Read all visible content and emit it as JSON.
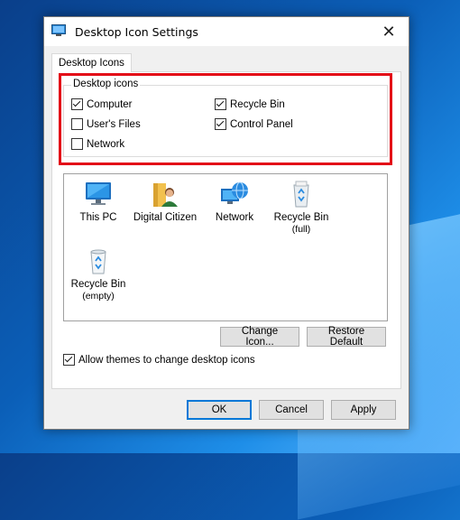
{
  "window": {
    "title": "Desktop Icon Settings",
    "close_glyph": "✕"
  },
  "tabs": [
    {
      "label": "Desktop Icons",
      "selected": true
    }
  ],
  "desktop_icons_group": {
    "legend": "Desktop icons",
    "checkboxes": [
      {
        "label": "Computer",
        "checked": true
      },
      {
        "label": "Recycle Bin",
        "checked": true
      },
      {
        "label": "User's Files",
        "checked": false
      },
      {
        "label": "Control Panel",
        "checked": true
      },
      {
        "label": "Network",
        "checked": false
      }
    ]
  },
  "icon_list": [
    {
      "label": "This PC",
      "sub": "",
      "icon": "monitor-icon"
    },
    {
      "label": "Digital Citizen",
      "sub": "",
      "icon": "user-folder-icon"
    },
    {
      "label": "Network",
      "sub": "",
      "icon": "network-globe-icon"
    },
    {
      "label": "Recycle Bin",
      "sub": "(full)",
      "icon": "recycle-bin-full-icon"
    },
    {
      "label": "Recycle Bin",
      "sub": "(empty)",
      "icon": "recycle-bin-empty-icon"
    }
  ],
  "buttons": {
    "change_icon": "Change Icon...",
    "restore_default": "Restore Default",
    "ok": "OK",
    "cancel": "Cancel",
    "apply": "Apply"
  },
  "allow_themes": {
    "label": "Allow themes to change desktop icons",
    "checked": true
  },
  "colors": {
    "highlight": "#e30a17",
    "accent": "#0078d7"
  }
}
